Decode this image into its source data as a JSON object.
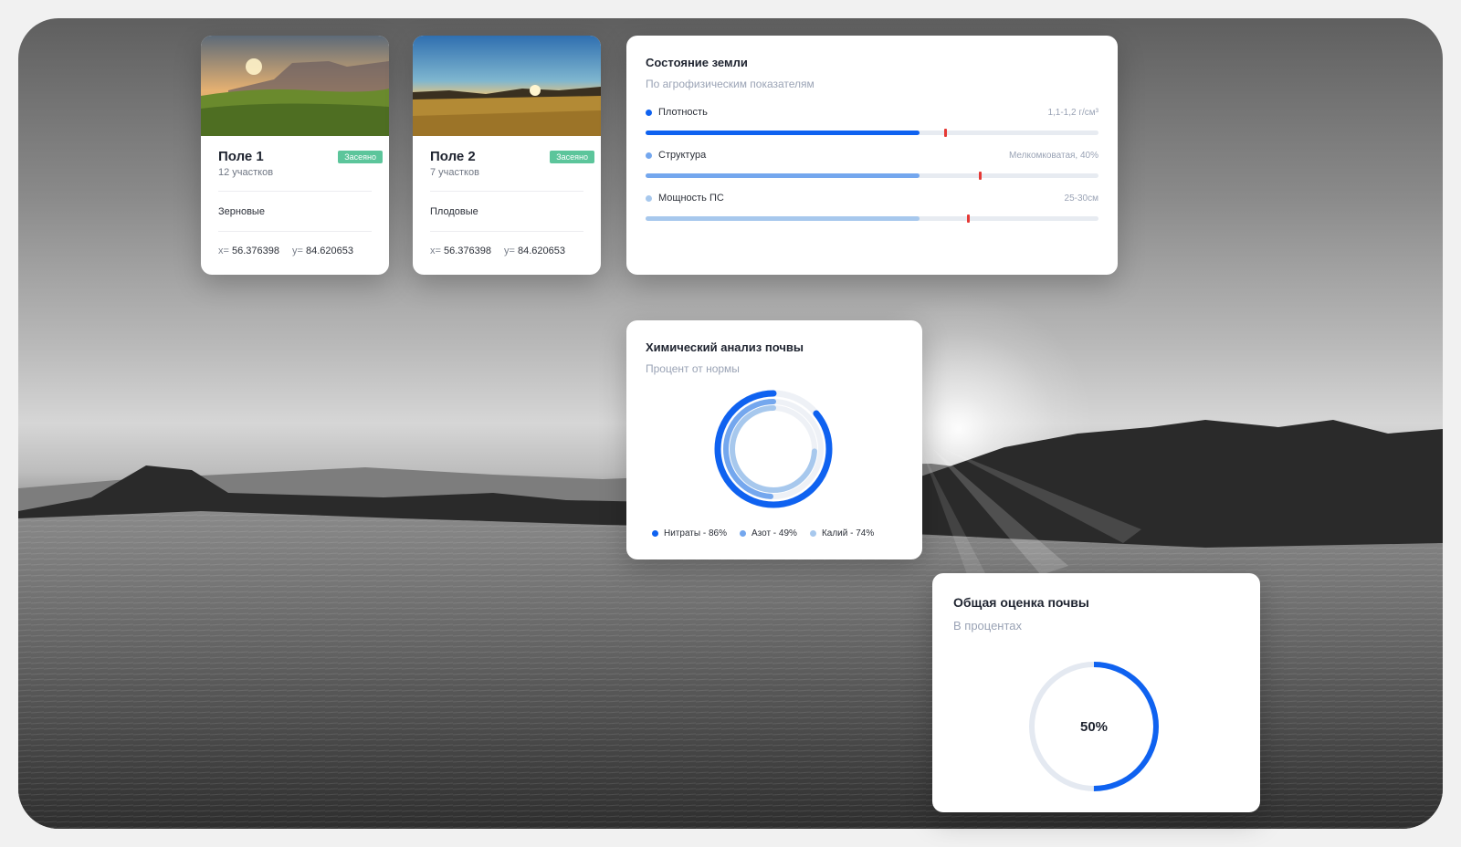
{
  "fields": [
    {
      "title": "Поле 1",
      "badge": "Засеяно",
      "plots": "12 участков",
      "crop": "Зерновые",
      "x_label": "x=",
      "x_value": "56.376398",
      "y_label": "y=",
      "y_value": "84.620653"
    },
    {
      "title": "Поле 2",
      "badge": "Засеяно",
      "plots": "7 участков",
      "crop": "Плодовые",
      "x_label": "x=",
      "x_value": "56.376398",
      "y_label": "y=",
      "y_value": "84.620653"
    }
  ],
  "soil_state": {
    "title": "Состояние земли",
    "subtitle": "По агрофизическим показателям",
    "metrics": [
      {
        "label": "Плотность",
        "value": "1,1-1,2 г/см³",
        "fill": 0.605,
        "marker": 0.66,
        "color": "#0f62f0"
      },
      {
        "label": "Структура",
        "value": "Мелкомковатая, 40%",
        "fill": 0.605,
        "marker": 0.735,
        "color": "#74a7ee"
      },
      {
        "label": "Мощность ПС",
        "value": "25-30см",
        "fill": 0.605,
        "marker": 0.71,
        "color": "#a7c8ed"
      }
    ],
    "marker_color": "#e53935"
  },
  "chem_analysis": {
    "title": "Химический анализ почвы",
    "subtitle": "Процент от нормы",
    "items": [
      {
        "label": "Нитраты - 86%",
        "percent": 86,
        "color": "#0f62f0"
      },
      {
        "label": "Азот - 49%",
        "percent": 49,
        "color": "#74a7ee"
      },
      {
        "label": "Калий - 74%",
        "percent": 74,
        "color": "#a7c8ed"
      }
    ]
  },
  "overall_score": {
    "title": "Общая оценка почвы",
    "subtitle": "В процентах",
    "percent": 50,
    "label": "50%",
    "color": "#0f62f0",
    "track_color": "#e4e9f1"
  }
}
